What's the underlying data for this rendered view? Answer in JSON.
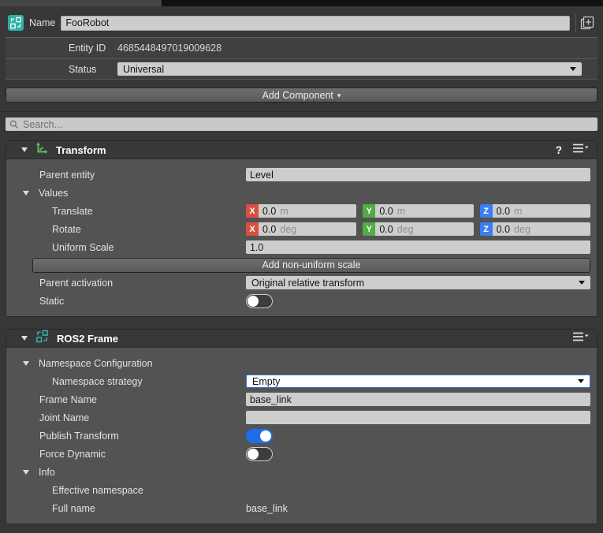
{
  "colors": {
    "axis_x": "#d84f3f",
    "axis_y": "#51ad44",
    "axis_z": "#3b7df3",
    "toggle_on": "#1e6deb",
    "component_teal": "#2fb1a6",
    "transform_icon_green": "#58bf63"
  },
  "header": {
    "name": {
      "label": "Name",
      "value": "FooRobot"
    },
    "entity_id": {
      "label": "Entity ID",
      "value": "4685448497019009628"
    },
    "status": {
      "label": "Status",
      "value": "Universal"
    },
    "add_component": {
      "label": "Add Component",
      "arrow": "▾"
    },
    "search": {
      "placeholder": "Search..."
    }
  },
  "transform": {
    "title": "Transform",
    "help": "?",
    "parent_entity": {
      "label": "Parent entity",
      "value": "Level"
    },
    "values_group": {
      "label": "Values"
    },
    "translate": {
      "label": "Translate",
      "unit": "m",
      "fields": [
        {
          "axis": "X",
          "value": "0.0"
        },
        {
          "axis": "Y",
          "value": "0.0"
        },
        {
          "axis": "Z",
          "value": "0.0"
        }
      ]
    },
    "rotate": {
      "label": "Rotate",
      "unit": "deg",
      "fields": [
        {
          "axis": "X",
          "value": "0.0"
        },
        {
          "axis": "Y",
          "value": "0.0"
        },
        {
          "axis": "Z",
          "value": "0.0"
        }
      ]
    },
    "uniform_scale": {
      "label": "Uniform Scale",
      "value": "1.0"
    },
    "add_non_uniform_scale": {
      "label": "Add non-uniform scale"
    },
    "parent_activation": {
      "label": "Parent activation",
      "value": "Original relative transform"
    },
    "static": {
      "label": "Static",
      "state": "off"
    }
  },
  "ros2_frame": {
    "title": "ROS2 Frame",
    "namespace_configuration": {
      "label": "Namespace Configuration"
    },
    "namespace_strategy": {
      "label": "Namespace strategy",
      "value": "Empty"
    },
    "frame_name": {
      "label": "Frame Name",
      "value": "base_link"
    },
    "joint_name": {
      "label": "Joint Name",
      "value": ""
    },
    "publish_transform": {
      "label": "Publish Transform",
      "state": "on"
    },
    "force_dynamic": {
      "label": "Force Dynamic",
      "state": "off"
    },
    "info_group": {
      "label": "Info"
    },
    "effective_namespace": {
      "label": "Effective namespace",
      "value": ""
    },
    "full_name": {
      "label": "Full name",
      "value": "base_link"
    }
  }
}
